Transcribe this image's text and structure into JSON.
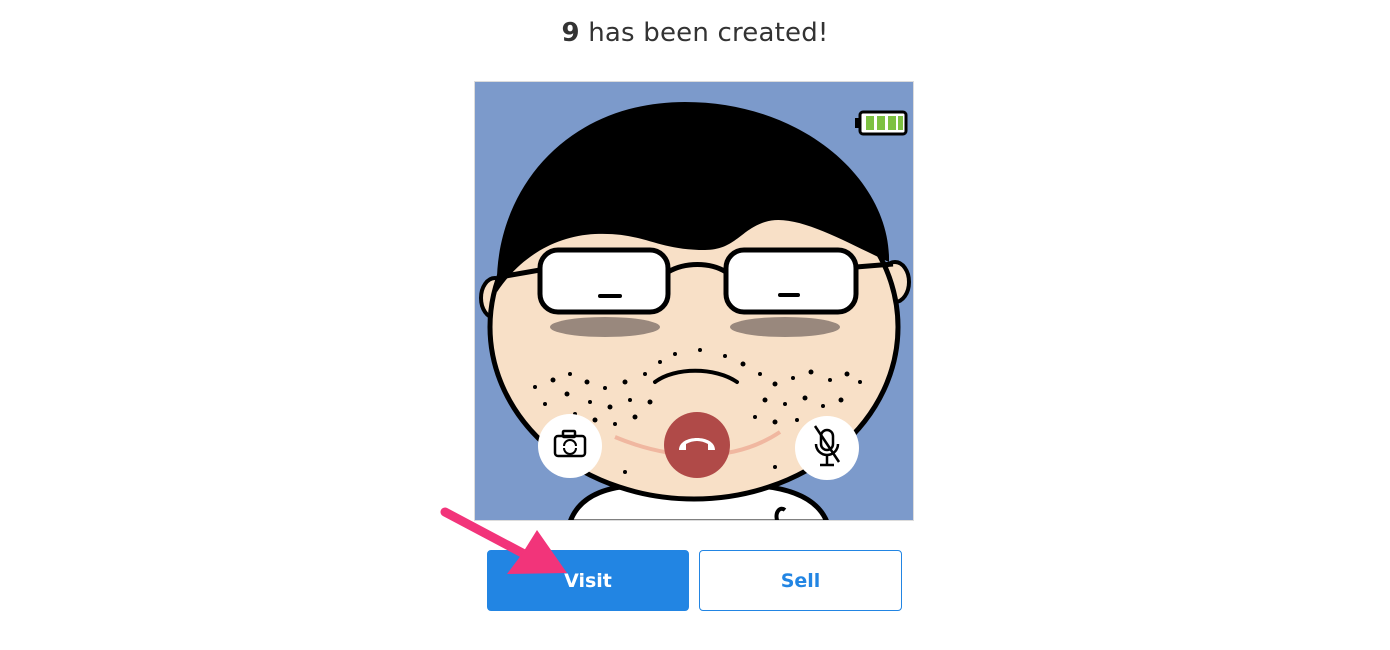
{
  "headline": {
    "number": "9",
    "text": " has been created!"
  },
  "image": {
    "background_color": "#7c9acb",
    "skin_color": "#f8e0c7",
    "hair_color": "#000000",
    "battery_color": "#7dc142",
    "hangup_color": "#b04a48"
  },
  "actions": {
    "visit_label": "Visit",
    "sell_label": "Sell"
  },
  "colors": {
    "accent": "#2285e3",
    "annotation_arrow": "#f2347a"
  }
}
